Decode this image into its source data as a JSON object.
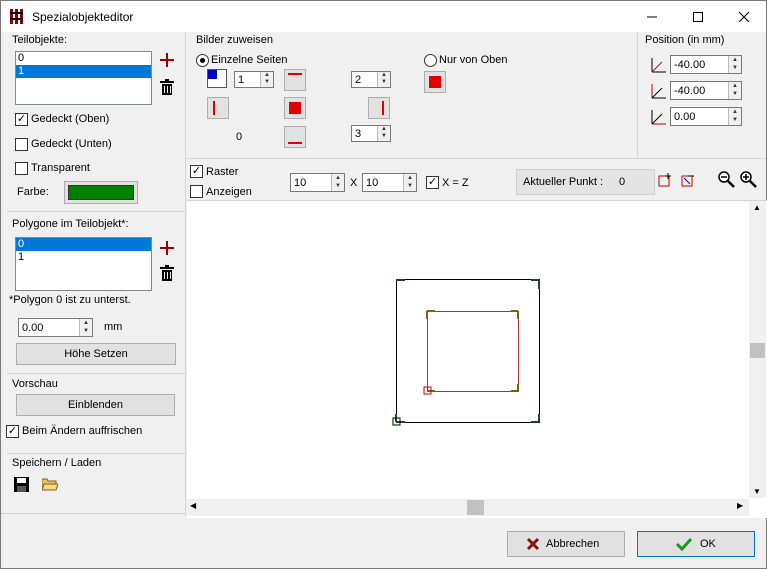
{
  "window": {
    "title": "Spezialobjekteditor"
  },
  "teilobjekte": {
    "label": "Teilobjekte:",
    "items": [
      "0",
      "1"
    ],
    "selected": 1
  },
  "options": {
    "gedeckt_oben": "Gedeckt (Oben)",
    "gedeckt_unten": "Gedeckt (Unten)",
    "transparent": "Transparent",
    "farbe": "Farbe:",
    "farbe_color": "#008000"
  },
  "polygone": {
    "label": "Polygone im Teilobjekt*:",
    "items": [
      "0",
      "1"
    ],
    "selected": 0,
    "note": "*Polygon 0 ist zu unterst.",
    "height_value": "0.00",
    "unit": "mm",
    "set_button": "Höhe Setzen"
  },
  "vorschau": {
    "label": "Vorschau",
    "button": "Einblenden",
    "refresh": "Beim Ändern auffrischen"
  },
  "save": {
    "label": "Speichern / Laden"
  },
  "bilder": {
    "label": "Bilder zuweisen",
    "einzelne": "Einzelne Seiten",
    "nur_oben": "Nur von Oben",
    "spin1": "1",
    "spin2": "2",
    "spin3": "3",
    "zero": "0"
  },
  "position": {
    "label": "Position (in mm)",
    "x": "-40.00",
    "y": "-40.00",
    "z": "0.00"
  },
  "toolbar": {
    "raster": "Raster",
    "anzeigen": "Anzeigen",
    "grid_x": "10",
    "grid_sep": "X",
    "grid_z": "10",
    "x_eq_z": "X = Z",
    "aktueller_label": "Aktueller Punkt :",
    "aktueller_value": "0"
  },
  "footer": {
    "cancel": "Abbrechen",
    "ok": "OK"
  }
}
